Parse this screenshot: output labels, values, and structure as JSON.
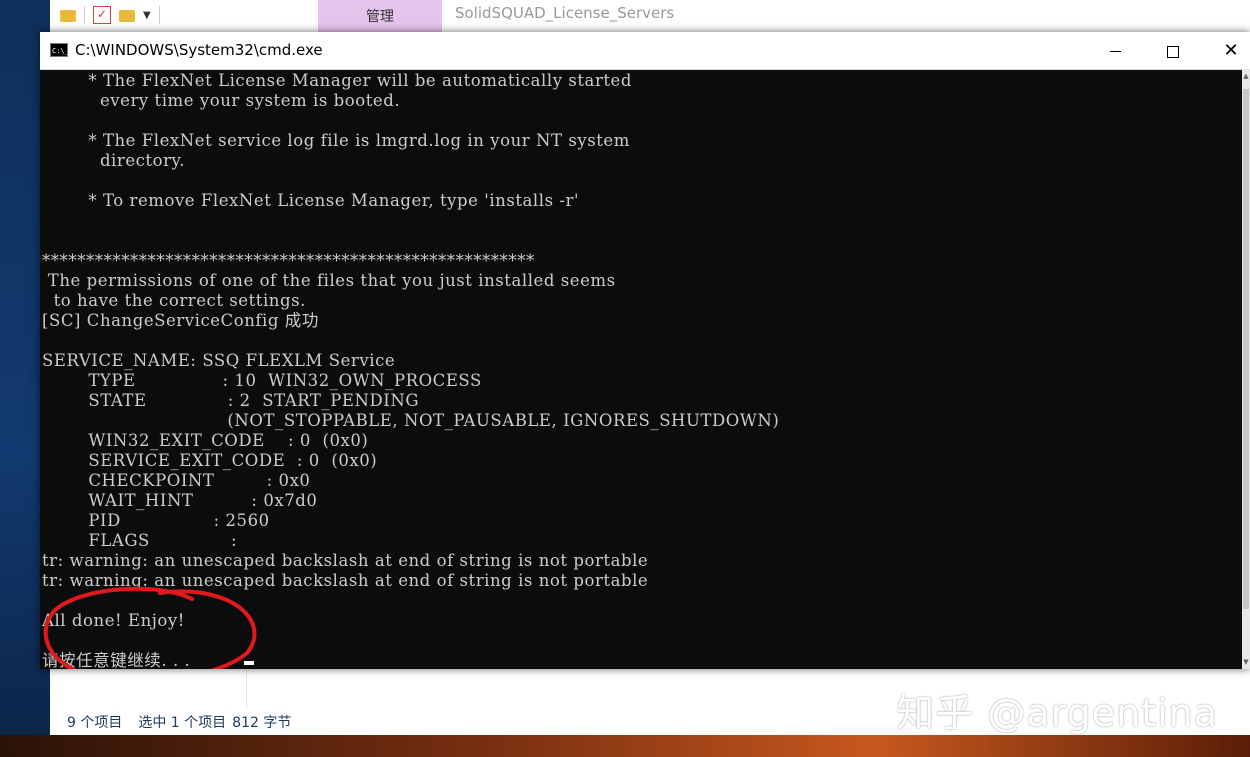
{
  "explorer": {
    "manage_tab": "管理",
    "title": "SolidSQUAD_License_Servers",
    "status": {
      "item_count": "9 个项目",
      "selected": "选中 1 个项目",
      "size": "812 字节"
    }
  },
  "cmd": {
    "title": "C:\\WINDOWS\\System32\\cmd.exe",
    "icon_text": "C:\\_",
    "lines": [
      "        * The FlexNet License Manager will be automatically started",
      "          every time your system is booted.",
      "",
      "        * The FlexNet service log file is lmgrd.log in your NT system",
      "          directory.",
      "",
      "        * To remove FlexNet License Manager, type 'installs -r'",
      "",
      "",
      "********************************************************",
      " The permissions of one of the files that you just installed seems",
      "  to have the correct settings.",
      "[SC] ChangeServiceConfig 成功",
      "",
      "SERVICE_NAME: SSQ FLEXLM Service",
      "        TYPE               : 10  WIN32_OWN_PROCESS",
      "        STATE              : 2  START_PENDING",
      "                                (NOT_STOPPABLE, NOT_PAUSABLE, IGNORES_SHUTDOWN)",
      "        WIN32_EXIT_CODE    : 0  (0x0)",
      "        SERVICE_EXIT_CODE  : 0  (0x0)",
      "        CHECKPOINT         : 0x0",
      "        WAIT_HINT          : 0x7d0",
      "        PID                : 2560",
      "        FLAGS              :",
      "tr: warning: an unescaped backslash at end of string is not portable",
      "tr: warning: an unescaped backslash at end of string is not portable",
      "",
      "All done! Enjoy!",
      "",
      "请按任意键继续. . ."
    ]
  },
  "watermark": "知乎 @argentina",
  "colors": {
    "console_bg": "#0c0c0c",
    "console_text": "#cccccc",
    "annotation_circle": "#e0191e",
    "manage_tab_bg": "#e4c4ea"
  }
}
